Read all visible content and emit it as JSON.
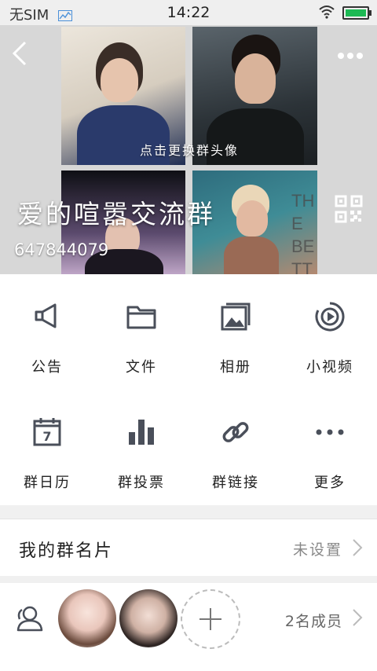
{
  "status_bar": {
    "sim_text": "无SIM",
    "time": "14:22",
    "battery_level": 1.0
  },
  "header": {
    "change_avatar_hint": "点击更换群头像",
    "group_name": "爱的喧嚣交流群",
    "group_id": "647844079",
    "tile_text": "THE BETTER DEED"
  },
  "functions": {
    "row1": [
      {
        "label": "公告",
        "icon": "megaphone-icon"
      },
      {
        "label": "文件",
        "icon": "folder-icon"
      },
      {
        "label": "相册",
        "icon": "photo-album-icon"
      },
      {
        "label": "小视频",
        "icon": "video-icon"
      }
    ],
    "row2": [
      {
        "label": "群日历",
        "icon": "calendar-icon"
      },
      {
        "label": "群投票",
        "icon": "bar-chart-icon"
      },
      {
        "label": "群链接",
        "icon": "link-icon"
      },
      {
        "label": "更多",
        "icon": "more-dots-icon"
      }
    ],
    "calendar_day": "7"
  },
  "group_card": {
    "title": "我的群名片",
    "value": "未设置"
  },
  "members": {
    "count_text": "2名成员"
  },
  "colors": {
    "icon_gray": "#4a4f5a",
    "battery_green": "#1db954",
    "divider": "#f0f0f0"
  }
}
